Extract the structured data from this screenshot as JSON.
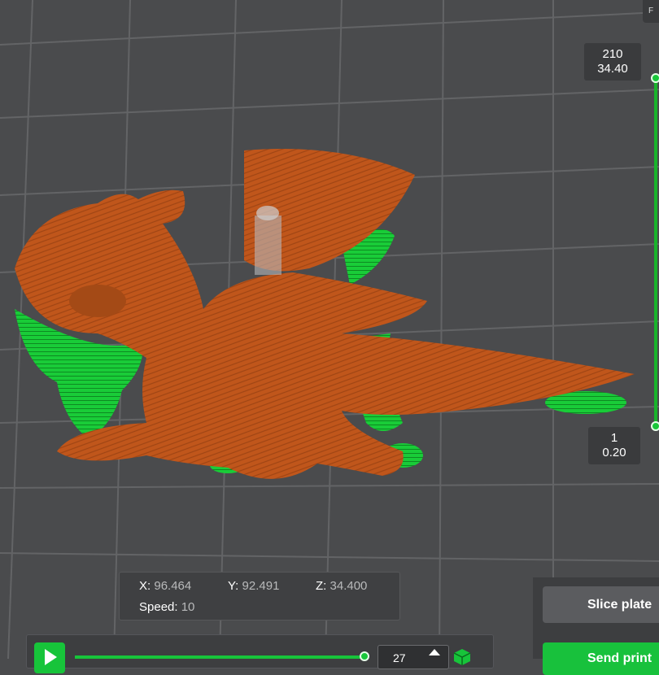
{
  "layer_slider": {
    "top_layer": "210",
    "top_height": "34.40",
    "bottom_layer": "1",
    "bottom_height": "0.20"
  },
  "corner_tab": {
    "label": "F"
  },
  "coordinates": {
    "x_label": "X:",
    "x_value": "96.464",
    "y_label": "Y:",
    "y_value": "92.491",
    "z_label": "Z:",
    "z_value": "34.400",
    "speed_label": "Speed:",
    "speed_value": "10"
  },
  "actions": {
    "slice_label": "Slice plate",
    "send_label": "Send print"
  },
  "playback": {
    "current_move": "27",
    "progress": 0.94
  },
  "colors": {
    "accent": "#17c43a",
    "model": "#c0561b",
    "support": "#17d13a",
    "plate": "#4a4b4d",
    "grid": "#6a6b6d"
  },
  "icons": {
    "play": "play-icon",
    "spin_up": "spin-up-icon",
    "cube": "cube-icon"
  }
}
